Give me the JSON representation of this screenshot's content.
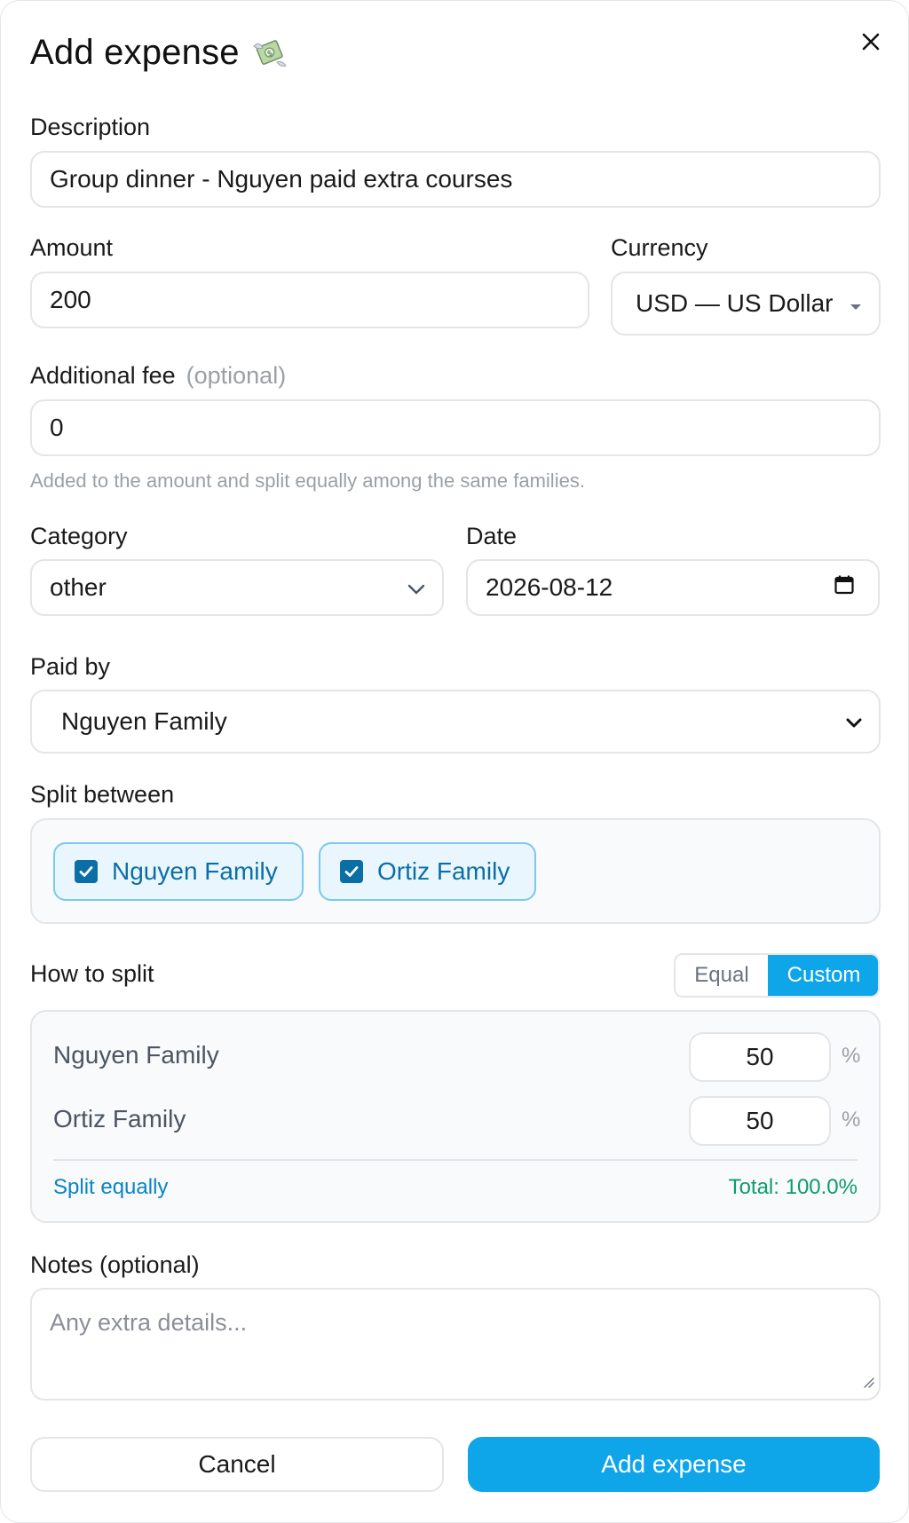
{
  "header": {
    "title": "Add expense",
    "icon": "money-with-wings-icon",
    "close_icon": "close-icon"
  },
  "description": {
    "label": "Description",
    "value": "Group dinner - Nguyen paid extra courses"
  },
  "amount": {
    "label": "Amount",
    "value": "200"
  },
  "currency": {
    "label": "Currency",
    "selected": "USD — US Dollar"
  },
  "fee": {
    "label": "Additional fee",
    "optional": "(optional)",
    "value": "0",
    "help": "Added to the amount and split equally among the same families."
  },
  "category": {
    "label": "Category",
    "selected": "other"
  },
  "date": {
    "label": "Date",
    "value": "2026-08-12"
  },
  "paid_by": {
    "label": "Paid by",
    "selected": "Nguyen Family"
  },
  "split_between": {
    "label": "Split between",
    "families": [
      {
        "name": "Nguyen Family",
        "checked": true
      },
      {
        "name": "Ortiz Family",
        "checked": true
      }
    ]
  },
  "how_to_split": {
    "label": "How to split",
    "mode_equal": "Equal",
    "mode_custom": "Custom",
    "active_mode": "Custom",
    "rows": [
      {
        "name": "Nguyen Family",
        "value": "50",
        "unit": "%"
      },
      {
        "name": "Ortiz Family",
        "value": "50",
        "unit": "%"
      }
    ],
    "split_equally_link": "Split equally",
    "total": "Total: 100.0%"
  },
  "notes": {
    "label": "Notes (optional)",
    "placeholder": "Any extra details..."
  },
  "footer": {
    "cancel_label": "Cancel",
    "submit_label": "Add expense"
  },
  "colors": {
    "accent": "#0ea5e9",
    "chip_border": "#7cc8ee",
    "chip_text": "#0b6fa6",
    "success": "#0f9b6e",
    "border": "#e3e5e8"
  }
}
